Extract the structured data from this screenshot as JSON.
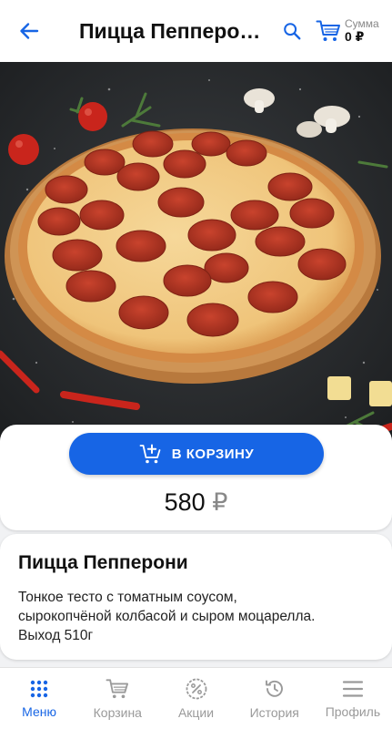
{
  "header": {
    "title": "Пицца Пепперо…",
    "cart_caption": "Сумма",
    "cart_sum": "0 ₽"
  },
  "product": {
    "add_button_label": "В КОРЗИНУ",
    "price_value": "580",
    "price_currency": "₽",
    "name": "Пицца Пепперони",
    "description_line1": "Тонкое тесто с томатным соусом,",
    "description_line2": "сырокопчёной колбасой и сыром моцарелла.",
    "description_line3": "Выход 510г"
  },
  "tabs": [
    {
      "label": "Меню",
      "icon": "grid-dots-icon",
      "active": true
    },
    {
      "label": "Корзина",
      "icon": "cart-icon",
      "active": false
    },
    {
      "label": "Акции",
      "icon": "percent-badge-icon",
      "active": false
    },
    {
      "label": "История",
      "icon": "history-icon",
      "active": false
    },
    {
      "label": "Профиль",
      "icon": "menu-icon",
      "active": false
    }
  ],
  "colors": {
    "accent": "#1765e5",
    "inactive": "#9a9a9a",
    "background": "#f1f2f4"
  }
}
